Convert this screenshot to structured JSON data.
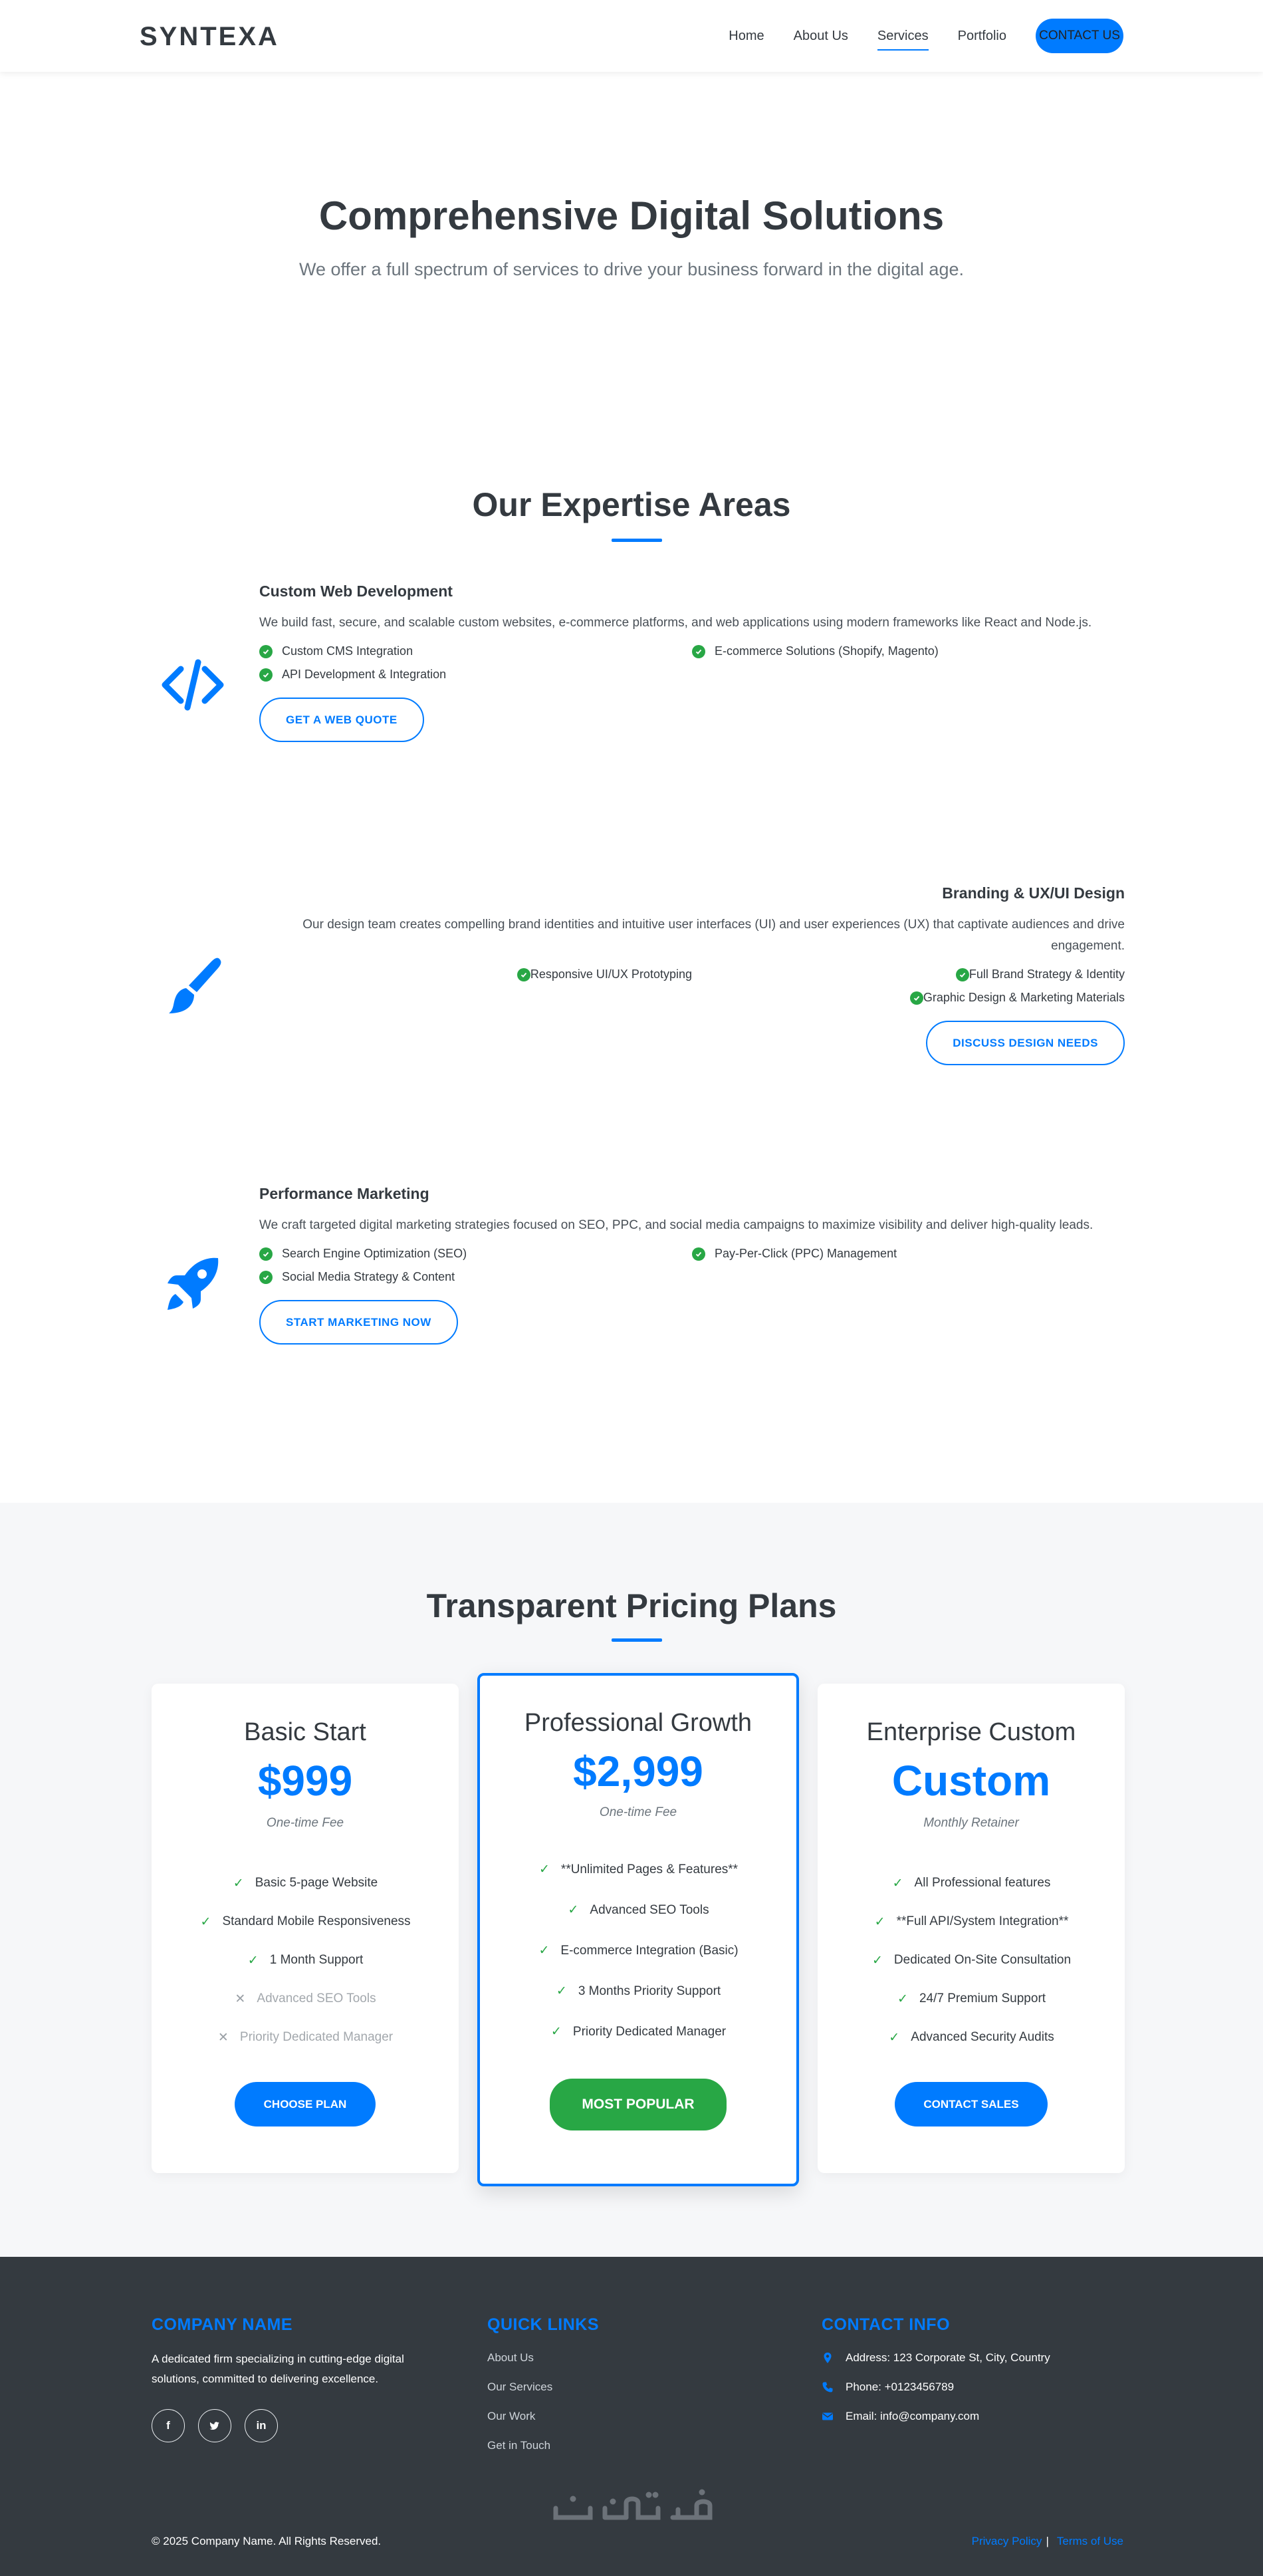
{
  "nav": {
    "brand": "SYNTEXA",
    "links": [
      "Home",
      "About Us",
      "Services",
      "Portfolio"
    ],
    "active": "Services",
    "cta": "CONTACT US"
  },
  "hero": {
    "title": "Comprehensive Digital Solutions",
    "subtitle": "We offer a full spectrum of services to drive your business forward in the digital age."
  },
  "expertise": {
    "title": "Our Expertise Areas",
    "services": [
      {
        "icon": "code-icon",
        "title": "Custom Web Development",
        "description": "We build fast, secure, and scalable custom websites, e-commerce platforms, and web applications using modern frameworks like React and Node.js.",
        "features": [
          "Custom CMS Integration",
          "E-commerce Solutions (Shopify, Magento)",
          "API Development & Integration"
        ],
        "button": "GET A WEB QUOTE"
      },
      {
        "icon": "paint-brush-icon",
        "title": "Branding & UX/UI Design",
        "description": "Our design team creates compelling brand identities and intuitive user interfaces (UI) and user experiences (UX) that captivate audiences and drive engagement.",
        "features": [
          "Full Brand Strategy & Identity",
          "Responsive UI/UX Prototyping",
          "Graphic Design & Marketing Materials"
        ],
        "button": "DISCUSS DESIGN NEEDS"
      },
      {
        "icon": "rocket-icon",
        "title": "Performance Marketing",
        "description": "We craft targeted digital marketing strategies focused on SEO, PPC, and social media campaigns to maximize visibility and deliver high-quality leads.",
        "features": [
          "Search Engine Optimization (SEO)",
          "Pay-Per-Click (PPC) Management",
          "Social Media Strategy & Content"
        ],
        "button": "START MARKETING NOW"
      }
    ]
  },
  "pricing": {
    "title": "Transparent Pricing Plans",
    "plans": [
      {
        "name": "Basic Start",
        "price": "$999",
        "period": "One-time Fee",
        "features": [
          {
            "text": "Basic 5-page Website",
            "included": true
          },
          {
            "text": "Standard Mobile Responsiveness",
            "included": true
          },
          {
            "text": "1 Month Support",
            "included": true
          },
          {
            "text": "Advanced SEO Tools",
            "included": false
          },
          {
            "text": "Priority Dedicated Manager",
            "included": false
          }
        ],
        "button": "CHOOSE PLAN"
      },
      {
        "name": "Professional Growth",
        "price": "$2,999",
        "period": "One-time Fee",
        "features": [
          {
            "text": "**Unlimited Pages & Features**",
            "included": true
          },
          {
            "text": "Advanced SEO Tools",
            "included": true
          },
          {
            "text": "E-commerce Integration (Basic)",
            "included": true
          },
          {
            "text": "3 Months Priority Support",
            "included": true
          },
          {
            "text": "Priority Dedicated Manager",
            "included": true
          }
        ],
        "button": "MOST POPULAR"
      },
      {
        "name": "Enterprise Custom",
        "price": "Custom",
        "period": "Monthly Retainer",
        "features": [
          {
            "text": "All Professional features",
            "included": true
          },
          {
            "text": "**Full API/System Integration**",
            "included": true
          },
          {
            "text": "Dedicated On-Site Consultation",
            "included": true
          },
          {
            "text": "24/7 Premium Support",
            "included": true
          },
          {
            "text": "Advanced Security Audits",
            "included": true
          }
        ],
        "button": "CONTACT SALES"
      }
    ]
  },
  "footer": {
    "company_title": "COMPANY NAME",
    "company_text": "A dedicated firm specializing in cutting-edge digital solutions, committed to delivering excellence.",
    "socials": [
      "f",
      "t",
      "in"
    ],
    "links_title": "QUICK LINKS",
    "links": [
      "About Us",
      "Our Services",
      "Our Work",
      "Get in Touch"
    ],
    "contact_title": "CONTACT INFO",
    "contact": [
      "Address: 123 Corporate St, City, Country",
      "Phone: +0123456789",
      "Email: info@company.com"
    ],
    "copyright": "© 2025 Company Name. All Rights Reserved.",
    "legal": [
      "Privacy Policy",
      "|",
      "Terms of Use"
    ]
  },
  "colors": {
    "accent": "#007bff",
    "success": "#28a745",
    "dark": "#343a40",
    "muted": "#6c757d",
    "pricing_bg": "#f6f7f9"
  }
}
